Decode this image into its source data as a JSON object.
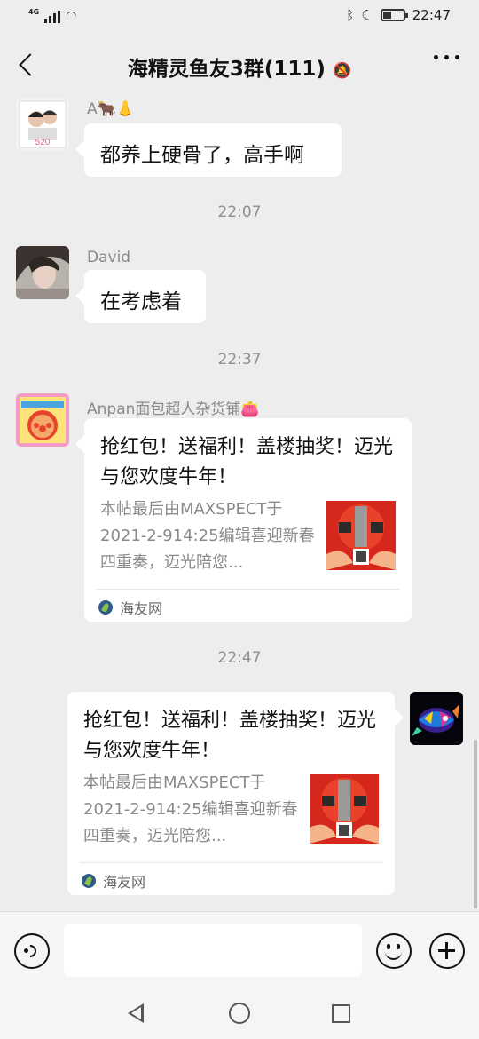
{
  "status_bar": {
    "network": "4G",
    "time": "22:47",
    "wifi_icon": "wifi-icon",
    "bluetooth_icon": "bluetooth-icon",
    "moon_icon": "do-not-disturb-icon"
  },
  "header": {
    "title": "海精灵鱼友3群(111)",
    "mute_icon": "🔕"
  },
  "messages": [
    {
      "sender": "A🐂👃",
      "text": "都养上硬骨了，高手啊"
    },
    {
      "time": "22:07"
    },
    {
      "sender": "David",
      "text": "在考虑着"
    },
    {
      "time": "22:37"
    },
    {
      "sender": "Anpan面包超人杂货铺👛",
      "card": {
        "title": "抢红包！送福利！盖楼抽奖！迈光与您欢度牛年！",
        "description": "本帖最后由MAXSPECT于2021-2-914:25编辑喜迎新春四重奏，迈光陪您...",
        "source": "海友网"
      }
    },
    {
      "time": "22:47"
    },
    {
      "self": true,
      "card": {
        "title": "抢红包！送福利！盖楼抽奖！迈光与您欢度牛年！",
        "description": "本帖最后由MAXSPECT于2021-2-914:25编辑喜迎新春四重奏，迈光陪您...",
        "source": "海友网"
      }
    }
  ],
  "colors": {
    "background": "#ededed",
    "bubble": "#ffffff",
    "thumb_red": "#d6271c"
  }
}
